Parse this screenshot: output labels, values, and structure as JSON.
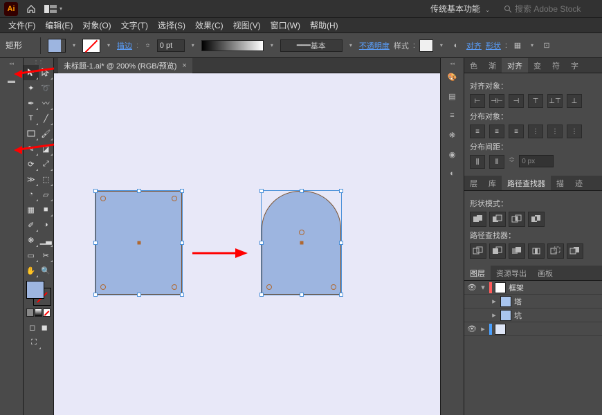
{
  "app": {
    "logo": "Ai"
  },
  "workspace": {
    "selected": "传统基本功能"
  },
  "search": {
    "placeholder": "搜索 Adobe Stock"
  },
  "menu": {
    "file": "文件(F)",
    "edit": "编辑(E)",
    "object": "对象(O)",
    "type": "文字(T)",
    "select": "选择(S)",
    "effect": "效果(C)",
    "view": "视图(V)",
    "window": "窗口(W)",
    "help": "帮助(H)"
  },
  "ctrl": {
    "shape_label": "矩形",
    "stroke_label": "描边",
    "stroke_weight": "0 pt",
    "profile_label": "基本",
    "opacity_label": "不透明度",
    "style_label": "样式",
    "align_label": "对齐",
    "shape_btn_label": "形状"
  },
  "document": {
    "tab_title": "未标题-1.ai* @ 200% (RGB/预览)"
  },
  "right": {
    "tabs1": {
      "color": "色",
      "gradient": "渐",
      "align": "对齐",
      "transform": "变",
      "symbol": "符",
      "glyph": "字"
    },
    "align": {
      "align_objects": "对齐对象：",
      "distribute_objects": "分布对象：",
      "distribute_spacing": "分布间距：",
      "spacing_value": "0 px"
    },
    "tabs2": {
      "layer": "层",
      "lib": "库",
      "pathfinder": "路径查找器",
      "stroke": "描",
      "trace": "迹"
    },
    "pathfinder": {
      "shape_modes": "形状模式：",
      "pathfinders": "路径查找器："
    },
    "tabs3": {
      "layers": "图层",
      "assets": "资源导出",
      "artboards": "画板"
    },
    "layers": [
      {
        "name": "框架",
        "expanded": false,
        "color": "#4aa0ff",
        "thumb": "#ffffff"
      },
      {
        "name": "塔",
        "expanded": false,
        "color": "#4aa0ff",
        "thumb": "#a9c5ee"
      },
      {
        "name": "坑",
        "expanded": false,
        "color": "#4aa0ff",
        "thumb": "#a9c5ee"
      }
    ]
  },
  "tools": {
    "selection": "selection-tool",
    "direct": "direct-selection-tool",
    "magic": "magic-wand-tool",
    "lasso": "lasso-tool",
    "pen": "pen-tool",
    "curvature": "curvature-tool",
    "type": "type-tool",
    "line": "line-tool",
    "rect": "rectangle-tool",
    "brush": "brush-tool",
    "shaper": "shaper-tool",
    "eraser": "eraser-tool",
    "rotate": "rotate-tool",
    "scale": "scale-tool",
    "width": "width-tool",
    "free": "free-transform-tool",
    "shape_builder": "shape-builder-tool",
    "perspective": "perspective-tool",
    "mesh": "mesh-tool",
    "gradient": "gradient-tool",
    "eyedropper": "eyedropper-tool",
    "blend": "blend-tool",
    "symbol": "symbol-sprayer-tool",
    "graph": "graph-tool",
    "artboard": "artboard-tool",
    "slice": "slice-tool",
    "hand": "hand-tool",
    "zoom": "zoom-tool"
  }
}
